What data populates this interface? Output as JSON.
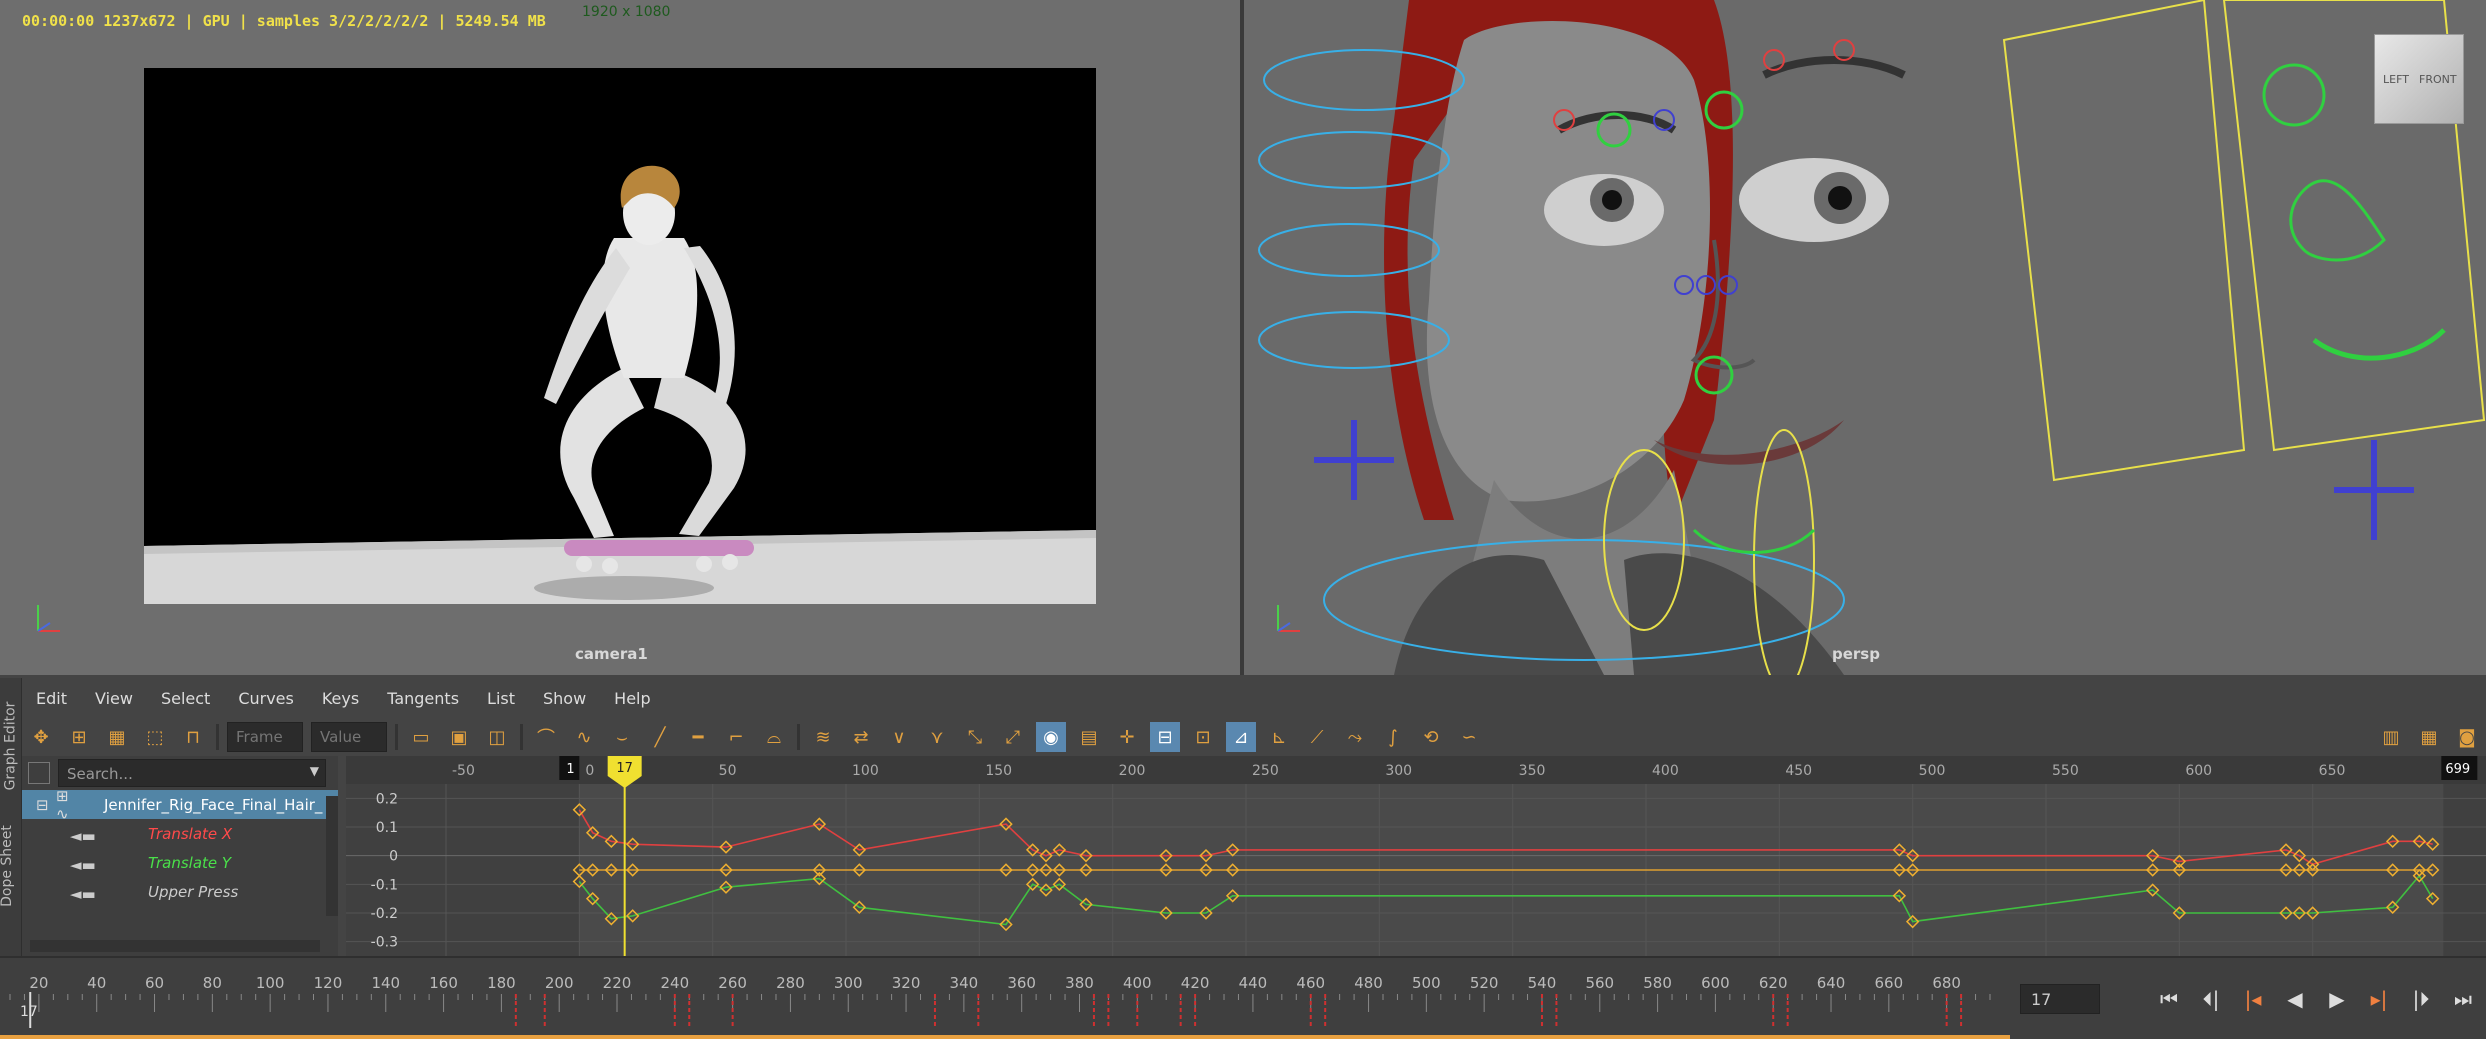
{
  "viewports": {
    "left": {
      "hud": "00:00:00 1237x672 | GPU | samples 3/2/2/2/2/2 | 5249.54 MB",
      "resolution": "1920 x 1080",
      "camera_label": "camera1"
    },
    "right": {
      "camera_label": "persp",
      "viewcube_left": "LEFT",
      "viewcube_front": "FRONT"
    }
  },
  "graph_editor": {
    "side_tabs": [
      "Graph Editor",
      "Dope Sheet"
    ],
    "menu": [
      "Edit",
      "View",
      "Select",
      "Curves",
      "Keys",
      "Tangents",
      "List",
      "Show",
      "Help"
    ],
    "frame_placeholder": "Frame",
    "value_placeholder": "Value",
    "search_placeholder": "Search...",
    "outliner": {
      "node": "Jennifer_Rig_Face_Final_Hair_",
      "channels": [
        {
          "label": "Translate X",
          "color": "#ff4a4a"
        },
        {
          "label": "Translate Y",
          "color": "#4ae04a"
        },
        {
          "label": "Upper Press",
          "color": "#cccccc"
        }
      ]
    },
    "graph": {
      "x_ticks": [
        "-50",
        "0",
        "50",
        "100",
        "150",
        "200",
        "250",
        "300",
        "350",
        "400",
        "450",
        "500",
        "550",
        "600",
        "650"
      ],
      "y_ticks": [
        "0.2",
        "0.1",
        "0",
        "-0.1",
        "-0.2",
        "-0.3"
      ],
      "start_marker": "1",
      "end_marker": "699",
      "current_frame_marker": "17"
    }
  },
  "chart_data": {
    "type": "line",
    "xlabel": "",
    "ylabel": "",
    "xlim": [
      -65,
      700
    ],
    "ylim": [
      -0.35,
      0.25
    ],
    "series": [
      {
        "name": "Translate X",
        "color": "#e04040",
        "x": [
          0,
          5,
          12,
          20,
          55,
          90,
          105,
          160,
          170,
          175,
          180,
          190,
          220,
          235,
          245,
          495,
          500,
          590,
          600,
          640,
          645,
          650,
          680,
          690,
          695
        ],
        "y": [
          0.16,
          0.08,
          0.05,
          0.04,
          0.03,
          0.11,
          0.02,
          0.11,
          0.02,
          0.0,
          0.02,
          0.0,
          0.0,
          0.0,
          0.02,
          0.02,
          0.0,
          0.0,
          -0.02,
          0.02,
          0.0,
          -0.03,
          0.05,
          0.05,
          0.04
        ]
      },
      {
        "name": "Translate Y",
        "color": "#40c040",
        "x": [
          0,
          5,
          12,
          20,
          55,
          90,
          105,
          160,
          170,
          175,
          180,
          190,
          220,
          235,
          245,
          495,
          500,
          590,
          600,
          640,
          645,
          650,
          680,
          690,
          695
        ],
        "y": [
          -0.09,
          -0.15,
          -0.22,
          -0.21,
          -0.11,
          -0.08,
          -0.18,
          -0.24,
          -0.1,
          -0.12,
          -0.1,
          -0.17,
          -0.2,
          -0.2,
          -0.14,
          -0.14,
          -0.23,
          -0.12,
          -0.2,
          -0.2,
          -0.2,
          -0.2,
          -0.18,
          -0.07,
          -0.15
        ]
      },
      {
        "name": "Upper Press",
        "color": "#e0a030",
        "x": [
          0,
          5,
          12,
          20,
          55,
          90,
          105,
          160,
          170,
          175,
          180,
          190,
          220,
          235,
          245,
          495,
          500,
          590,
          600,
          640,
          645,
          650,
          680,
          690,
          695
        ],
        "y": [
          -0.05,
          -0.05,
          -0.05,
          -0.05,
          -0.05,
          -0.05,
          -0.05,
          -0.05,
          -0.05,
          -0.05,
          -0.05,
          -0.05,
          -0.05,
          -0.05,
          -0.05,
          -0.05,
          -0.05,
          -0.05,
          -0.05,
          -0.05,
          -0.05,
          -0.05,
          -0.05,
          -0.05,
          -0.05
        ]
      }
    ]
  },
  "time_slider": {
    "ticks": [
      "20",
      "40",
      "60",
      "80",
      "100",
      "120",
      "140",
      "160",
      "180",
      "200",
      "220",
      "240",
      "260",
      "280",
      "300",
      "320",
      "340",
      "360",
      "380",
      "400",
      "420",
      "440",
      "460",
      "480",
      "500",
      "520",
      "540",
      "560",
      "580",
      "600",
      "620",
      "640",
      "660",
      "680"
    ],
    "current_frame_small": "17",
    "current_frame": "17",
    "accent_color": "#e8a040"
  }
}
